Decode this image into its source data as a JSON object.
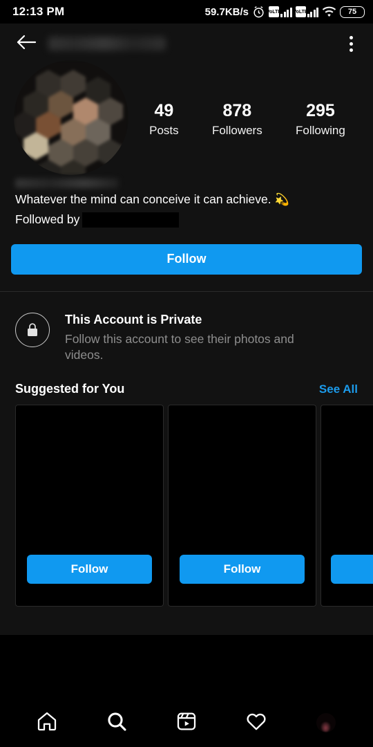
{
  "status_bar": {
    "clock": "12:13 PM",
    "network_speed": "59.7KB/s",
    "alarm_icon": "alarm-clock-icon",
    "sim1_label": "VoLTE",
    "sim2_label": "VoLTE",
    "wifi_icon": "wifi-icon",
    "battery_level": "75"
  },
  "top_nav": {
    "back_icon": "back-arrow-icon",
    "username": "",
    "menu_icon": "overflow-menu-icon"
  },
  "profile": {
    "avatar_alt": "profile-picture",
    "display_name": "",
    "stats": [
      {
        "value": "49",
        "label": "Posts"
      },
      {
        "value": "878",
        "label": "Followers"
      },
      {
        "value": "295",
        "label": "Following"
      }
    ],
    "bio": "Whatever the mind can conceive it can achieve.",
    "bio_emoji": "💫",
    "followed_by_label": "Followed by",
    "followed_by_name": ""
  },
  "follow_button": {
    "label": "Follow"
  },
  "private_notice": {
    "lock_icon": "lock-icon",
    "title": "This Account is Private",
    "subtitle": "Follow this account to see their photos and videos."
  },
  "suggested": {
    "title": "Suggested for You",
    "see_all_label": "See All",
    "cards": [
      {
        "follow_label": "Follow"
      },
      {
        "follow_label": "Follow"
      },
      {
        "follow_label": ""
      }
    ]
  },
  "bottom_nav": {
    "items": [
      {
        "name": "home-icon"
      },
      {
        "name": "search-icon"
      },
      {
        "name": "reels-icon"
      },
      {
        "name": "heart-icon"
      },
      {
        "name": "profile-avatar-icon"
      }
    ]
  },
  "colors": {
    "accent_blue": "#1099F0",
    "link_blue": "#1C9BEB",
    "background": "#121212",
    "secondary_text": "#8E8E8E"
  }
}
